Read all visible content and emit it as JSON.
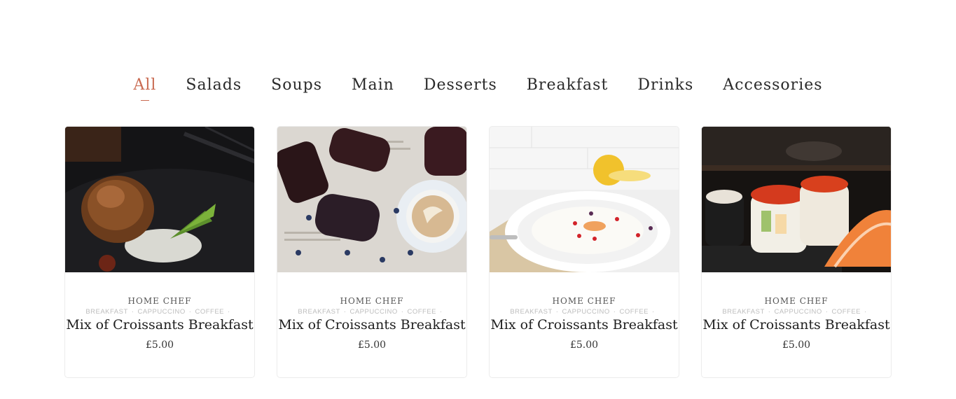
{
  "tabs": [
    {
      "label": "All",
      "active": true
    },
    {
      "label": "Salads",
      "active": false
    },
    {
      "label": "Soups",
      "active": false
    },
    {
      "label": "Main",
      "active": false
    },
    {
      "label": "Desserts",
      "active": false
    },
    {
      "label": "Breakfast",
      "active": false
    },
    {
      "label": "Drinks",
      "active": false
    },
    {
      "label": "Accessories",
      "active": false
    }
  ],
  "colors": {
    "accent": "#c96b52"
  },
  "cards": [
    {
      "image": "food-photo-fried-dish",
      "chef": "HOME CHEF",
      "tags": [
        "BREAKFAST",
        "CAPPUCCINO",
        "COFFEE"
      ],
      "title": "Mix of Croissants Breakfast",
      "price": "£5.00"
    },
    {
      "image": "food-photo-toasts-coffee",
      "chef": "HOME CHEF",
      "tags": [
        "BREAKFAST",
        "CAPPUCCINO",
        "COFFEE"
      ],
      "title": "Mix of Croissants Breakfast",
      "price": "£5.00"
    },
    {
      "image": "food-photo-soup-bowl",
      "chef": "HOME CHEF",
      "tags": [
        "BREAKFAST",
        "CAPPUCCINO",
        "COFFEE"
      ],
      "title": "Mix of Croissants Breakfast",
      "price": "£5.00"
    },
    {
      "image": "food-photo-sushi",
      "chef": "HOME CHEF",
      "tags": [
        "BREAKFAST",
        "CAPPUCCINO",
        "COFFEE"
      ],
      "title": "Mix of Croissants Breakfast",
      "price": "£5.00"
    }
  ]
}
